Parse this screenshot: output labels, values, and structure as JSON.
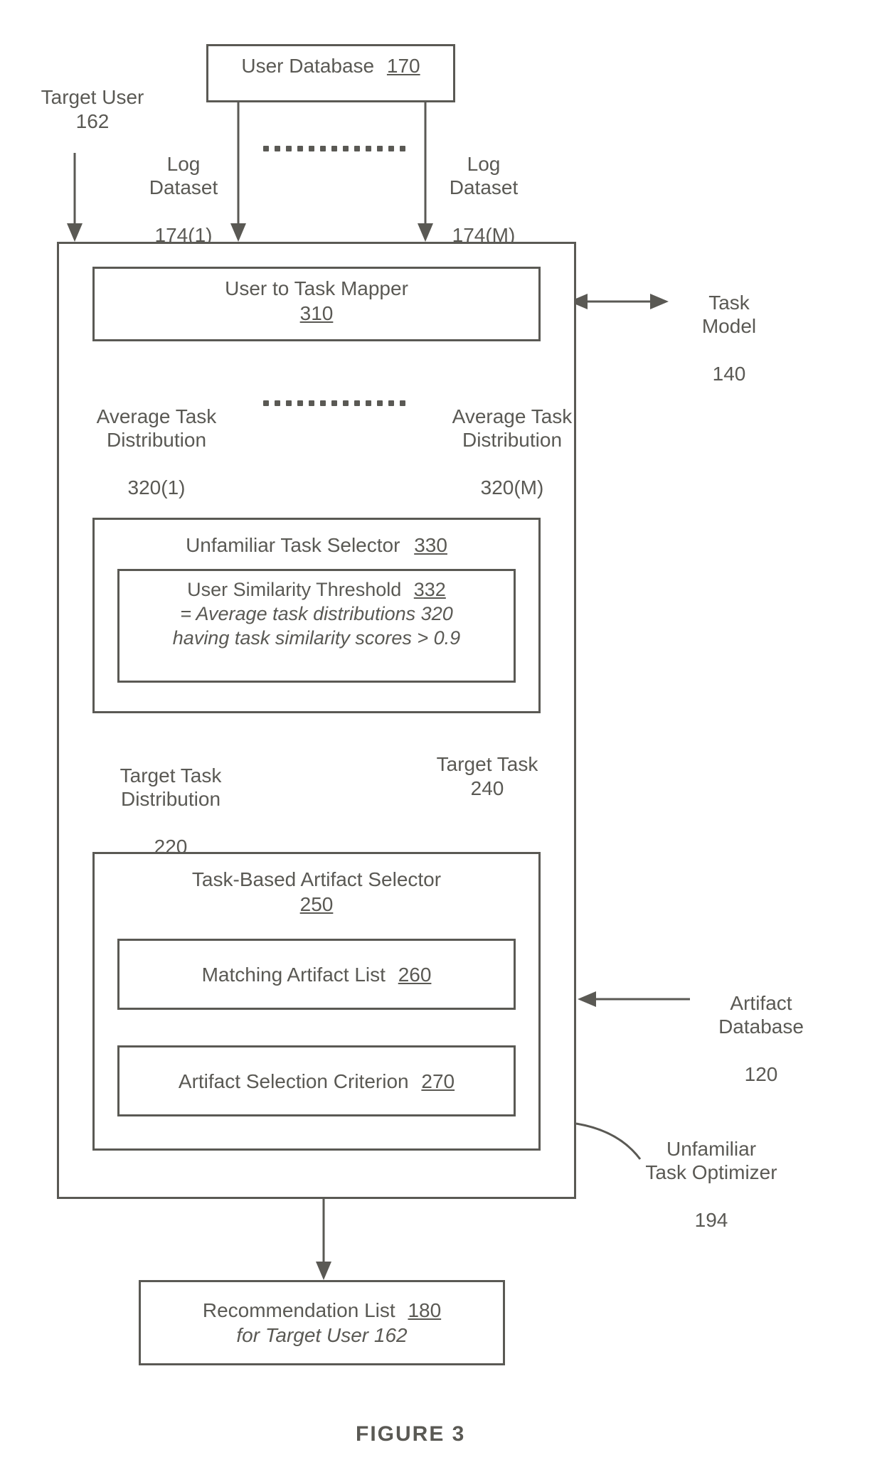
{
  "top": {
    "user_db_label": "User Database",
    "user_db_ref": "170",
    "target_user_label": "Target User",
    "target_user_ref": "162",
    "log_ds_label": "Log\nDataset",
    "log_ds_ref_1": "174(1)",
    "log_ds_ref_m": "174(M)"
  },
  "mapper": {
    "title": "User to Task Mapper",
    "ref": "310",
    "task_model_label": "Task\nModel",
    "task_model_ref": "140"
  },
  "avg_dist": {
    "label": "Average Task\nDistribution",
    "ref_1": "320(1)",
    "ref_m": "320(M)"
  },
  "selector": {
    "title": "Unfamiliar Task Selector",
    "title_ref": "330",
    "inner_title": "User Similarity Threshold",
    "inner_ref": "332",
    "inner_line1": "= Average task distributions 320",
    "inner_line2": "having task similarity scores > 0.9"
  },
  "targets": {
    "dist_label": "Target Task\nDistribution",
    "dist_ref": "220",
    "task_label": "Target Task",
    "task_ref": "240"
  },
  "artifact": {
    "title": "Task-Based Artifact Selector",
    "ref": "250",
    "match_label": "Matching Artifact List",
    "match_ref": "260",
    "crit_label": "Artifact Selection Criterion",
    "crit_ref": "270",
    "db_label": "Artifact\nDatabase",
    "db_ref": "120"
  },
  "container": {
    "label": "Unfamiliar\nTask Optimizer",
    "ref": "194"
  },
  "rec": {
    "title": "Recommendation List",
    "ref": "180",
    "sub": "for Target User 162"
  },
  "figure": "FIGURE 3"
}
